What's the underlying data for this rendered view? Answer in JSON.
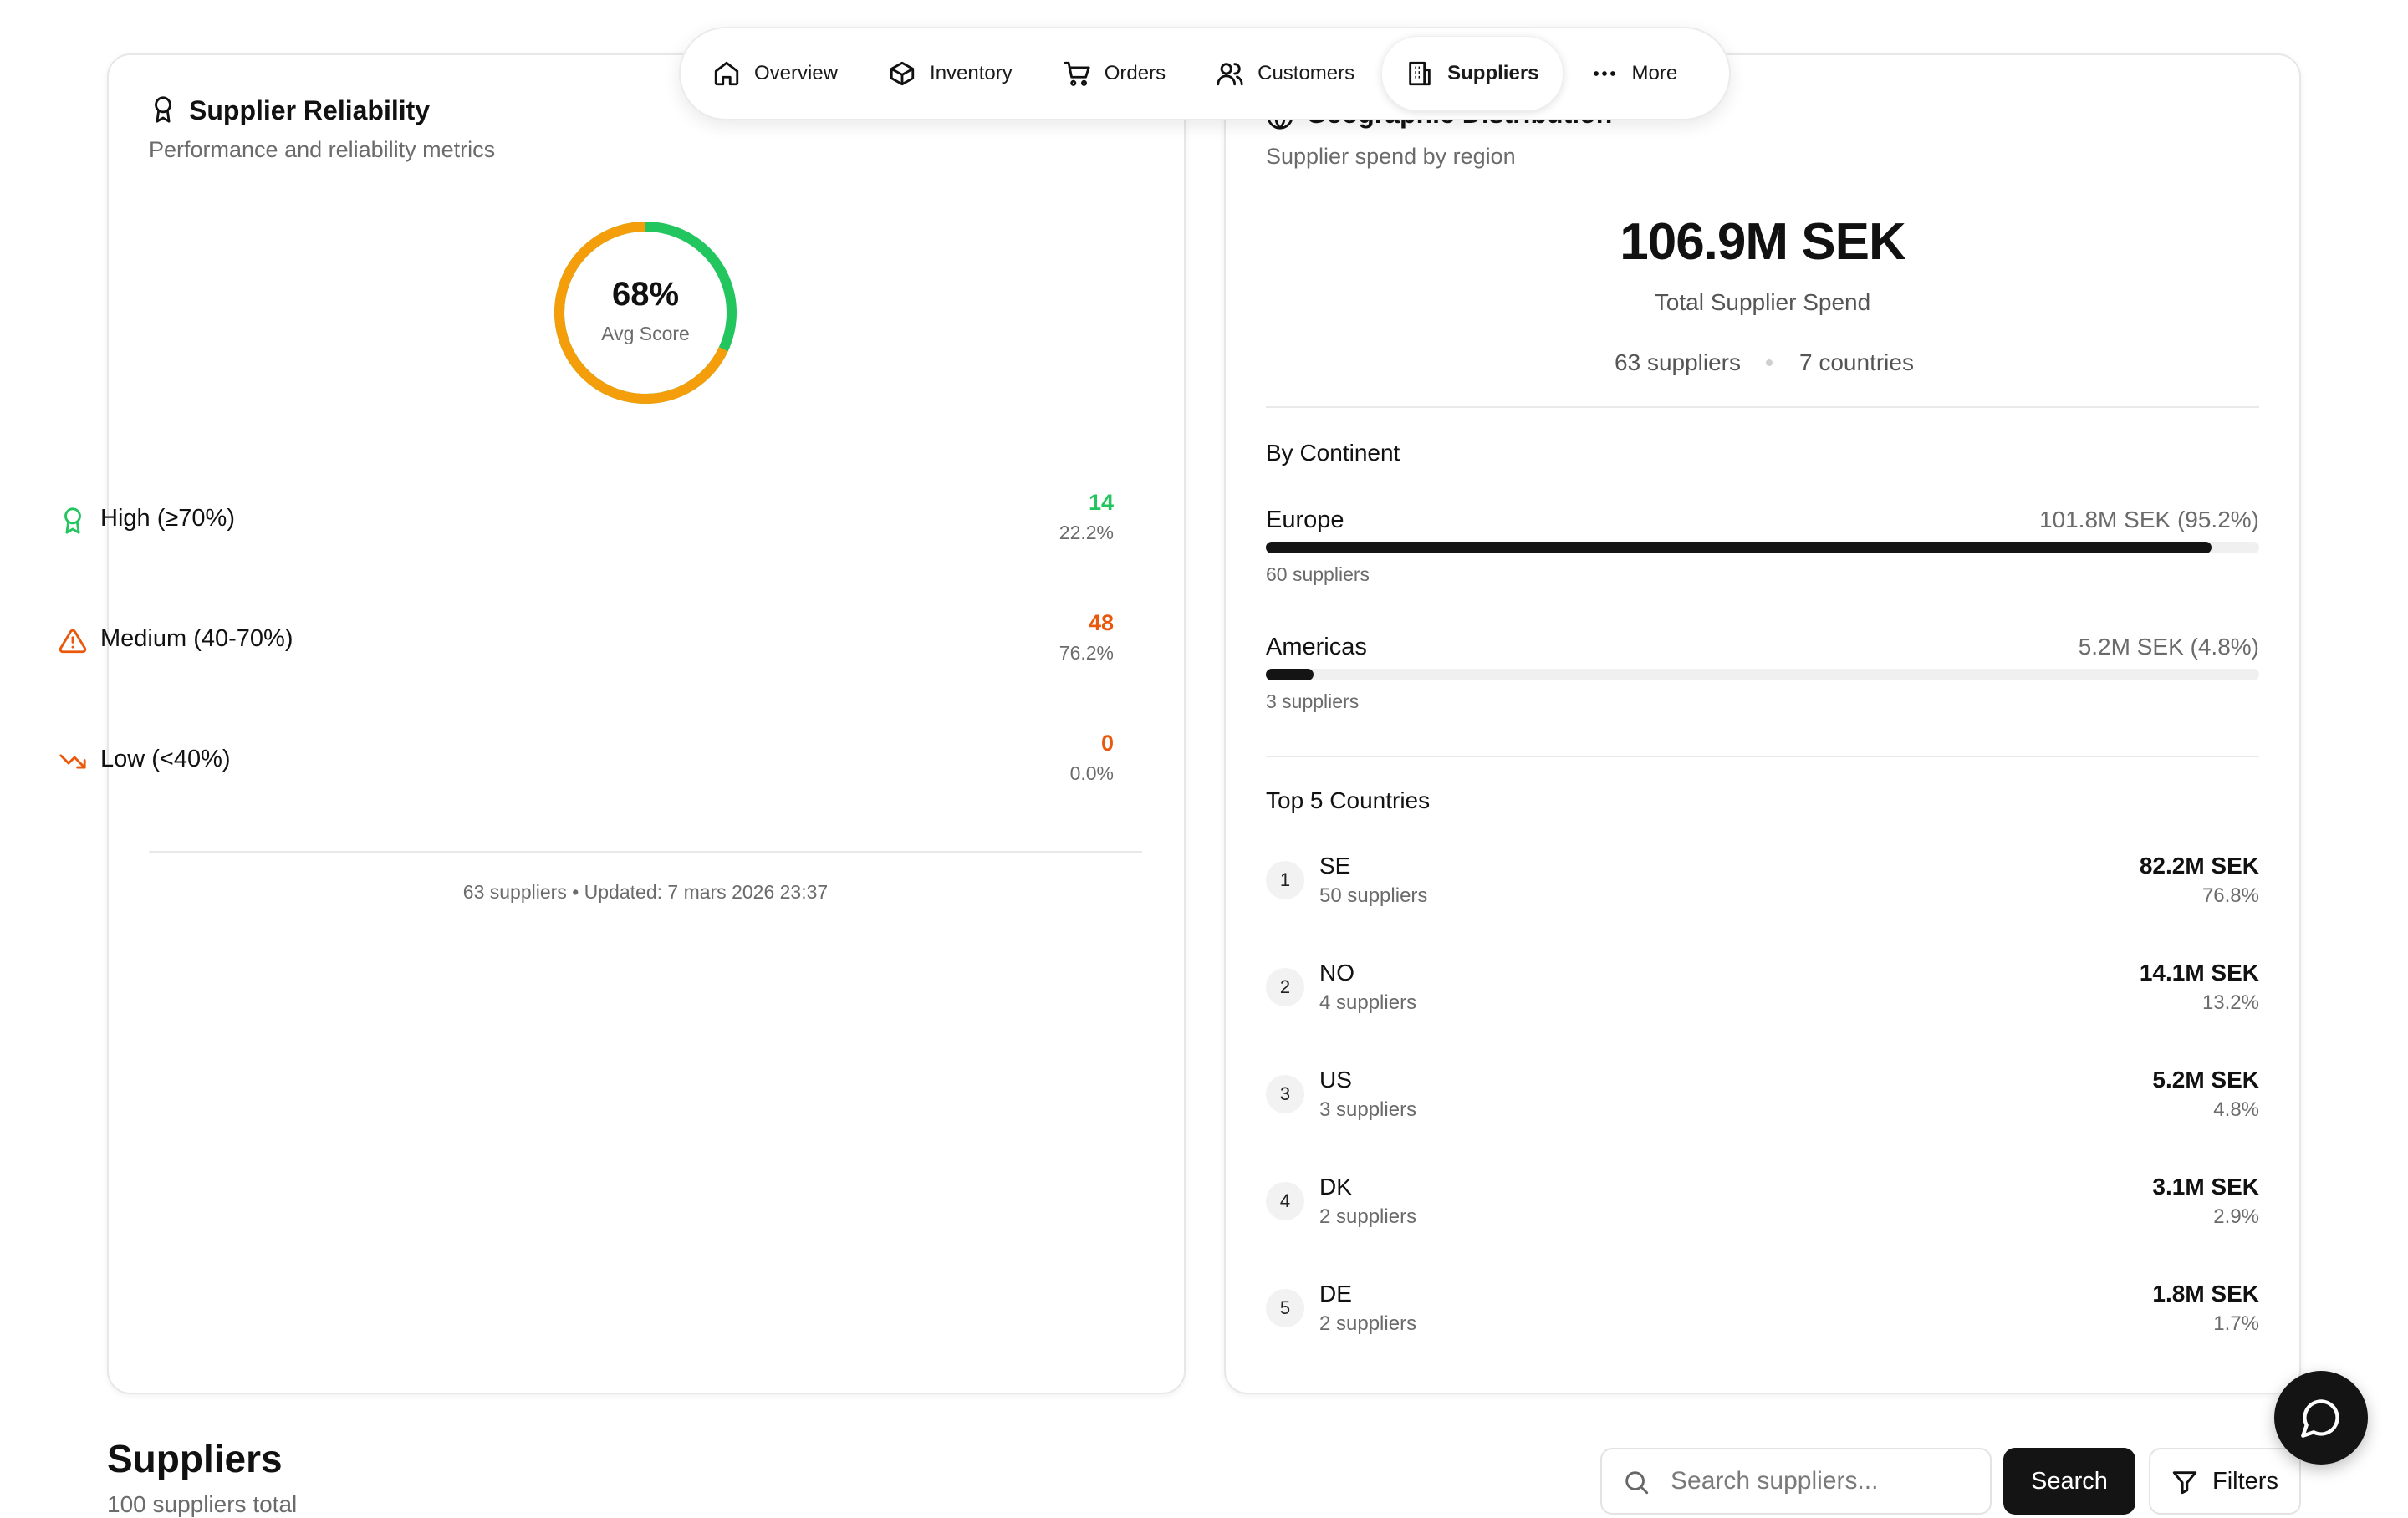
{
  "nav": {
    "items": [
      {
        "label": "Overview",
        "icon": "home-icon"
      },
      {
        "label": "Inventory",
        "icon": "package-icon"
      },
      {
        "label": "Orders",
        "icon": "cart-icon"
      },
      {
        "label": "Customers",
        "icon": "users-icon"
      },
      {
        "label": "Suppliers",
        "icon": "building-icon",
        "active": true
      },
      {
        "label": "More",
        "icon": "more-dots-icon"
      }
    ]
  },
  "reliability": {
    "title": "Supplier Reliability",
    "subtitle": "Performance and reliability metrics",
    "gauge": {
      "value": "68%",
      "label": "Avg Score",
      "fraction": 0.68,
      "colors": {
        "score": "#f59e0b",
        "track": "#22c55e"
      }
    },
    "tiers": [
      {
        "label": "High (≥70%)",
        "count": "14",
        "pct": "22.2%",
        "color": "#22c55e",
        "icon": "award-icon"
      },
      {
        "label": "Medium (40-70%)",
        "count": "48",
        "pct": "76.2%",
        "color": "#ea580c",
        "icon": "warning-icon"
      },
      {
        "label": "Low (<40%)",
        "count": "0",
        "pct": "0.0%",
        "color": "#ea580c",
        "icon": "trending-down-icon"
      }
    ],
    "footer": "63 suppliers • Updated: 7 mars 2026 23:37"
  },
  "geo": {
    "title": "Geographic Distribution",
    "subtitle": "Supplier spend by region",
    "total": "106.9M SEK",
    "total_label": "Total Supplier Spend",
    "supplier_count": "63 suppliers",
    "country_count": "7 countries",
    "continent_title": "By Continent",
    "continents": [
      {
        "name": "Europe",
        "value": "101.8M SEK (95.2%)",
        "suppliers": "60 suppliers",
        "share": 0.952
      },
      {
        "name": "Americas",
        "value": "5.2M SEK (4.8%)",
        "suppliers": "3 suppliers",
        "share": 0.048
      }
    ],
    "countries_title": "Top 5 Countries",
    "countries": [
      {
        "rank": "1",
        "code": "SE",
        "suppliers": "50 suppliers",
        "amount": "82.2M SEK",
        "pct": "76.8%"
      },
      {
        "rank": "2",
        "code": "NO",
        "suppliers": "4 suppliers",
        "amount": "14.1M SEK",
        "pct": "13.2%"
      },
      {
        "rank": "3",
        "code": "US",
        "suppliers": "3 suppliers",
        "amount": "5.2M SEK",
        "pct": "4.8%"
      },
      {
        "rank": "4",
        "code": "DK",
        "suppliers": "2 suppliers",
        "amount": "3.1M SEK",
        "pct": "2.9%"
      },
      {
        "rank": "5",
        "code": "DE",
        "suppliers": "2 suppliers",
        "amount": "1.8M SEK",
        "pct": "1.7%"
      }
    ]
  },
  "suppliers_section": {
    "heading": "Suppliers",
    "count_text": "100 suppliers total",
    "search_placeholder": "Search suppliers...",
    "search_value": "",
    "search_button": "Search",
    "filters_button": "Filters"
  },
  "colors": {
    "accent_dark": "#141414",
    "high": "#22c55e",
    "medium": "#ea580c",
    "gauge": "#f59e0b"
  }
}
